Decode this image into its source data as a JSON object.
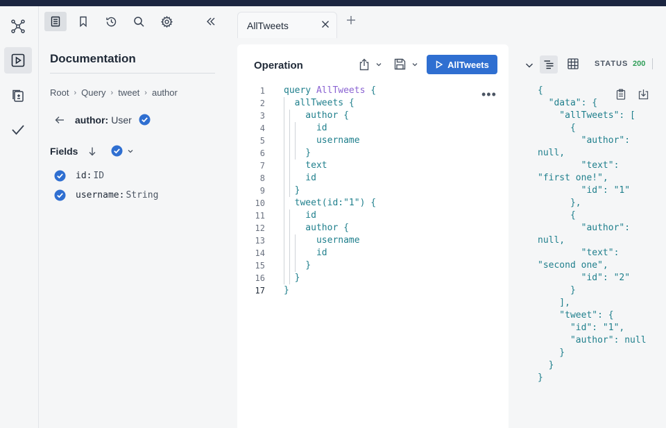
{
  "sidebar": {
    "icons": [
      "graph-icon",
      "play-icon",
      "history-copy-icon",
      "check-icon"
    ]
  },
  "docs": {
    "title": "Documentation",
    "breadcrumbs": [
      "Root",
      "Query",
      "tweet",
      "author"
    ],
    "type_field": "author:",
    "type_name": "User",
    "fields_label": "Fields",
    "fields": [
      {
        "name": "id:",
        "type": "ID"
      },
      {
        "name": "username:",
        "type": "String"
      }
    ]
  },
  "tabs": [
    {
      "label": "AllTweets"
    }
  ],
  "operation": {
    "title": "Operation",
    "run_label": "AllTweets",
    "lines": [
      {
        "n": "1",
        "text": "query AllTweets {"
      },
      {
        "n": "2",
        "text": "  allTweets {"
      },
      {
        "n": "3",
        "text": "    author {"
      },
      {
        "n": "4",
        "text": "      id"
      },
      {
        "n": "5",
        "text": "      username"
      },
      {
        "n": "6",
        "text": "    }"
      },
      {
        "n": "7",
        "text": "    text"
      },
      {
        "n": "8",
        "text": "    id"
      },
      {
        "n": "9",
        "text": "  }"
      },
      {
        "n": "10",
        "text": "  tweet(id:\"1\") {"
      },
      {
        "n": "11",
        "text": "    id"
      },
      {
        "n": "12",
        "text": "    author {"
      },
      {
        "n": "13",
        "text": "      username"
      },
      {
        "n": "14",
        "text": "      id"
      },
      {
        "n": "15",
        "text": "    }"
      },
      {
        "n": "16",
        "text": "  }"
      },
      {
        "n": "17",
        "text": "}"
      }
    ]
  },
  "result": {
    "status_label": "STATUS",
    "status_code": "200",
    "lines": [
      "{",
      "  \"data\": {",
      "    \"allTweets\": [",
      "      {",
      "        \"author\":",
      "null,",
      "        \"text\":",
      "\"first one!\",",
      "        \"id\": \"1\"",
      "      },",
      "      {",
      "        \"author\":",
      "null,",
      "        \"text\":",
      "\"second one\",",
      "        \"id\": \"2\"",
      "      }",
      "    ],",
      "    \"tweet\": {",
      "      \"id\": \"1\",",
      "      \"author\": null",
      "    }",
      "  }",
      "}"
    ]
  },
  "colors": {
    "accent": "#2f6fd1",
    "check": "#2f6fd1",
    "status_ok": "#2e9d57",
    "code_keyword": "#1f7f8c",
    "code_name": "#8a63d2"
  }
}
